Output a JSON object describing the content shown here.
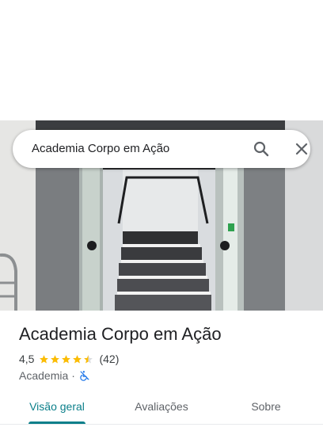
{
  "search": {
    "query": "Academia Corpo em Ação"
  },
  "place": {
    "name": "Academia Corpo em Ação",
    "rating": "4,5",
    "rating_value": 4.5,
    "review_count": "(42)",
    "category": "Academia",
    "separator": "·"
  },
  "tabs": [
    {
      "label": "Visão geral",
      "active": true
    },
    {
      "label": "Avaliações",
      "active": false
    },
    {
      "label": "Sobre",
      "active": false
    }
  ],
  "colors": {
    "accent": "#0b7f8a",
    "star": "#fbbc04",
    "accessibility_icon": "#1a73e8"
  },
  "icons": {
    "search": "search-icon",
    "close": "close-icon",
    "accessibility": "wheelchair-not-accessible-icon"
  }
}
